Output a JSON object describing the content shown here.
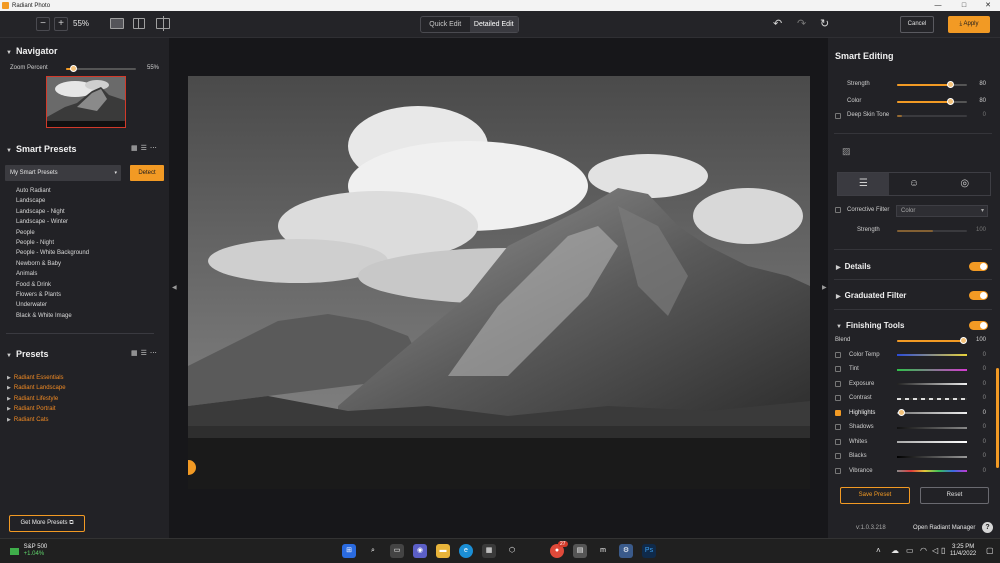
{
  "window": {
    "title": "Radiant Photo",
    "min": "—",
    "max": "□",
    "close": "✕"
  },
  "toolbar": {
    "zoom_out": "−",
    "zoom_in": "+",
    "zoom_value": "55%",
    "mode_quick": "Quick Edit",
    "mode_detailed": "Detailed Edit",
    "undo": "↶",
    "redo": "↷",
    "reset": "↻",
    "cancel": "Cancel",
    "apply": "Apply",
    "apply_icon": "⤓"
  },
  "navigator": {
    "title": "Navigator",
    "zoom_label": "Zoom Percent",
    "zoom_value": "55%",
    "zoom_level": 0.55
  },
  "smart_presets": {
    "title": "Smart Presets",
    "selected": "My Smart Presets",
    "detect": "Detect",
    "items": [
      "Auto Radiant",
      "Landscape",
      "Landscape - Night",
      "Landscape - Winter",
      "People",
      "People - Night",
      "People - White Background",
      "Newborn & Baby",
      "Animals",
      "Food & Drink",
      "Flowers & Plants",
      "Underwater",
      "Black & White Image"
    ]
  },
  "presets": {
    "title": "Presets",
    "items": [
      "Radiant Essentials",
      "Radiant Landscape",
      "Radiant Lifestyle",
      "Radiant Portrait",
      "Radiant Cats"
    ]
  },
  "get_more": "Get More Presets",
  "smart_editing": {
    "title": "Smart Editing",
    "strength_label": "Strength",
    "strength_value": "80",
    "color_label": "Color",
    "color_value": "80",
    "deep_skin_label": "Deep Skin Tone",
    "deep_skin_value": "0"
  },
  "corrective": {
    "label": "Corrective Filter",
    "select": "Color",
    "strength_label": "Strength",
    "strength_value": "100"
  },
  "sections": {
    "details": "Details",
    "graduated": "Graduated Filter",
    "finishing": "Finishing Tools"
  },
  "finishing": {
    "blend_label": "Blend",
    "blend_value": "100",
    "rows": [
      {
        "label": "Color Temp",
        "value": "0"
      },
      {
        "label": "Tint",
        "value": "0"
      },
      {
        "label": "Exposure",
        "value": "0"
      },
      {
        "label": "Contrast",
        "value": "0"
      },
      {
        "label": "Highlights",
        "value": "0"
      },
      {
        "label": "Shadows",
        "value": "0"
      },
      {
        "label": "Whites",
        "value": "0"
      },
      {
        "label": "Blacks",
        "value": "0"
      },
      {
        "label": "Vibrance",
        "value": "0"
      }
    ]
  },
  "buttons": {
    "save_preset": "Save Preset",
    "reset": "Reset"
  },
  "footer": {
    "version": "v:1.0.3.218",
    "open_manager": "Open Radiant Manager",
    "help": "?"
  },
  "taskbar": {
    "stock_name": "S&P 500",
    "stock_change": "+1.04%",
    "badge": "27",
    "time": "3:25 PM",
    "date": "11/4/2022"
  },
  "colors": {
    "accent": "#f29a24",
    "panel": "#222226",
    "canvas": "#17171a"
  }
}
